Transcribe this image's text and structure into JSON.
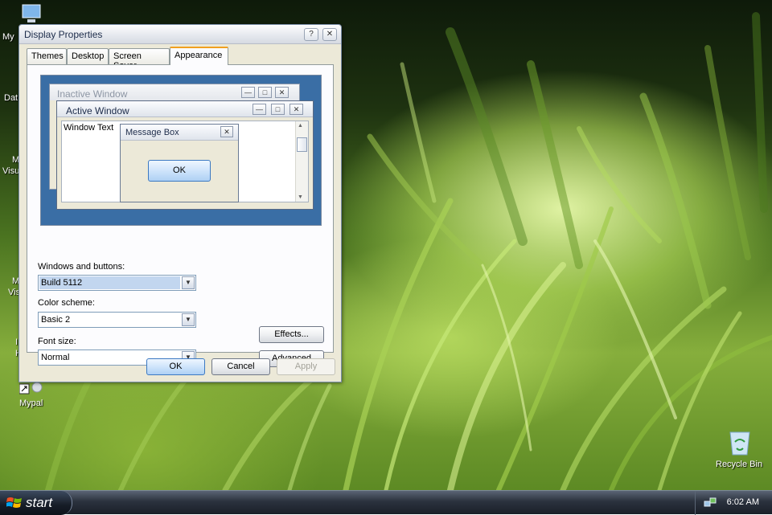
{
  "desktop": {
    "icons": [
      {
        "label": "My"
      },
      {
        "label": "Dat"
      },
      {
        "label": "M"
      },
      {
        "label": "Visu"
      },
      {
        "label": "M"
      },
      {
        "label": "Vis"
      },
      {
        "label": "I"
      },
      {
        "label": "H"
      },
      {
        "label": "Mypal"
      },
      {
        "label": "Recycle Bin"
      }
    ]
  },
  "window": {
    "title": "Display Properties",
    "help_glyph": "?",
    "close_glyph": "✕",
    "tabs": [
      {
        "label": "Themes"
      },
      {
        "label": "Desktop"
      },
      {
        "label": "Screen Saver"
      },
      {
        "label": "Appearance",
        "active": true
      }
    ],
    "preview": {
      "inactive_title": "Inactive Window",
      "active_title": "Active Window",
      "window_text": "Window Text",
      "message_box_title": "Message Box",
      "ok_label": "OK",
      "min_glyph": "—",
      "max_glyph": "□",
      "close_glyph": "✕"
    },
    "fields": {
      "windows_buttons_label": "Windows and buttons:",
      "windows_buttons_value": "Build 5112",
      "color_scheme_label": "Color scheme:",
      "color_scheme_value": "Basic 2",
      "font_size_label": "Font size:",
      "font_size_value": "Normal"
    },
    "side_buttons": {
      "effects": "Effects...",
      "advanced": "Advanced"
    },
    "footer": {
      "ok": "OK",
      "cancel": "Cancel",
      "apply": "Apply"
    }
  },
  "taskbar": {
    "start_label": "start",
    "clock": "6:02 AM"
  },
  "colors": {
    "preview_desktop": "#3a6ea5",
    "accent": "#3c79c2",
    "active_tab": "#f0a020"
  }
}
